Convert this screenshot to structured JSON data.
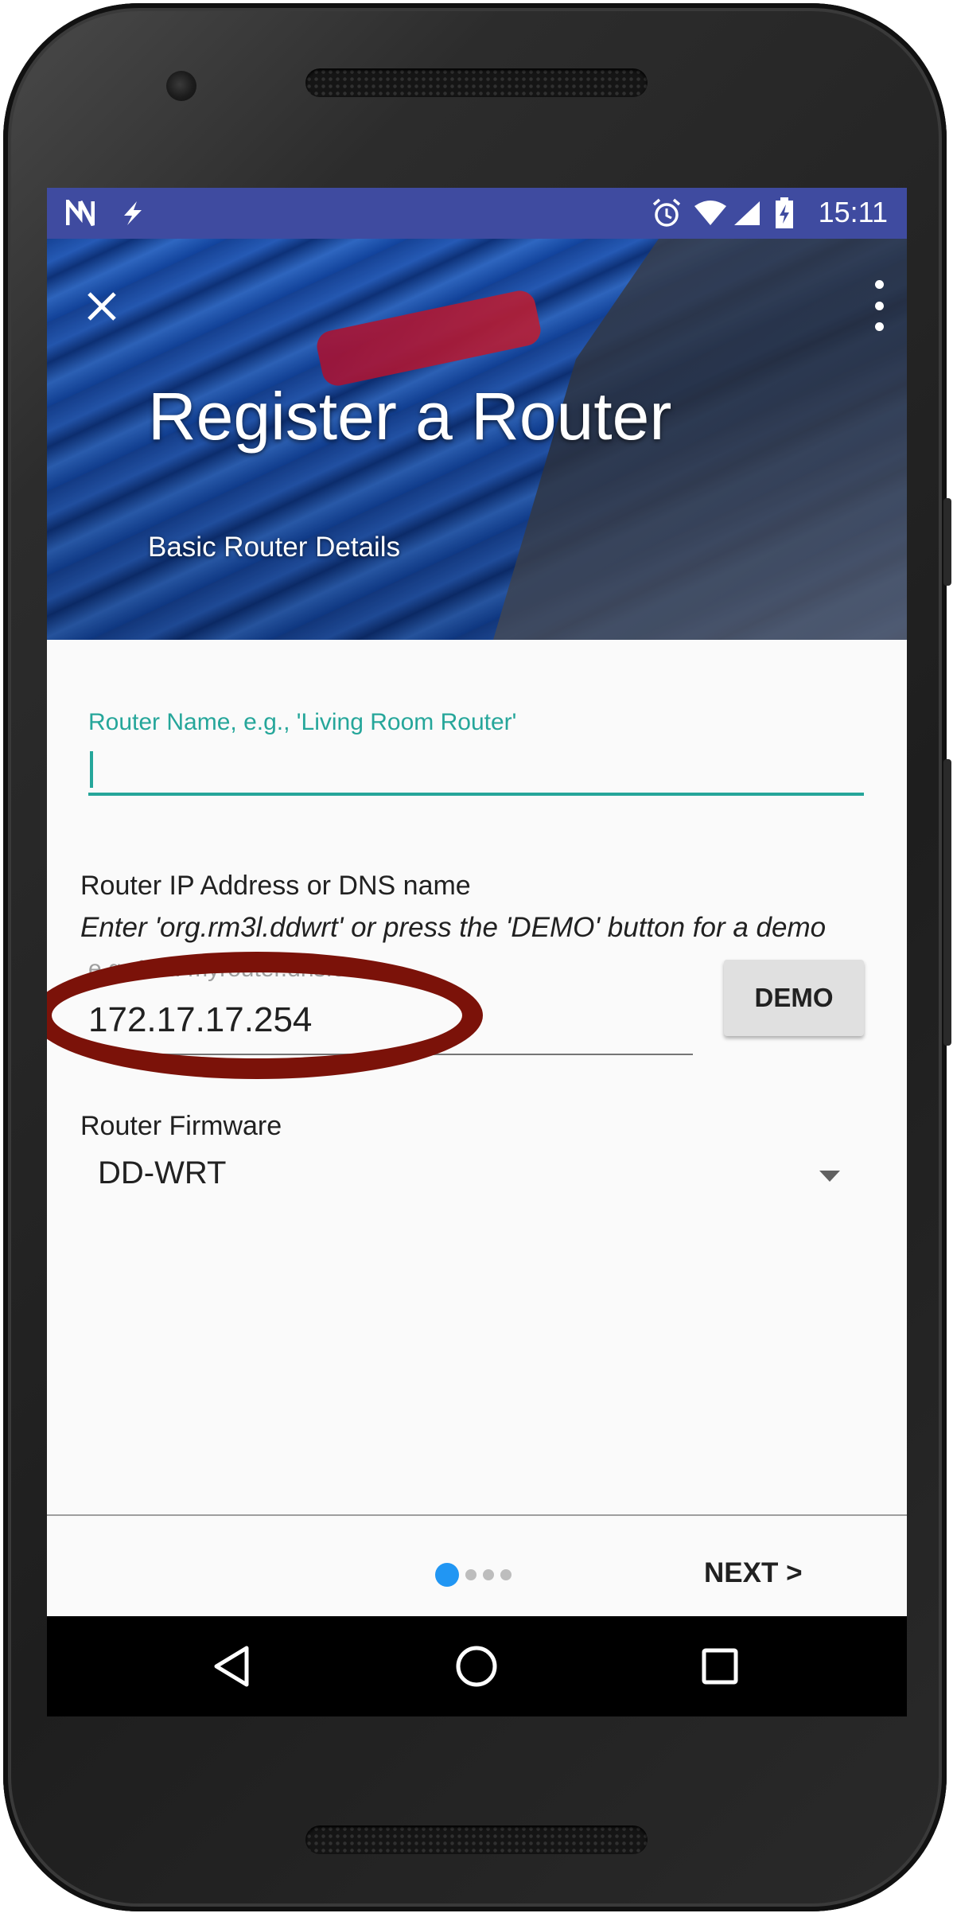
{
  "status_bar": {
    "time": "15:11",
    "left_icons": [
      "n-notification-icon",
      "bolt-icon"
    ],
    "right_icons": [
      "alarm-icon",
      "wifi-icon",
      "signal-icon",
      "battery-icon"
    ]
  },
  "header": {
    "title": "Register a Router",
    "subtitle": "Basic Router Details"
  },
  "form": {
    "router_name": {
      "label": "Router Name, e.g., 'Living Room Router'",
      "value": ""
    },
    "router_ip": {
      "label": "Router IP Address or DNS name",
      "hint": "Enter 'org.rm3l.ddwrt' or press the 'DEMO' button for a demo",
      "placeholder_visible": "e.g. 192.                     myrouter.dns.com",
      "value": "172.17.17.254"
    },
    "demo_button_label": "DEMO",
    "firmware": {
      "label": "Router Firmware",
      "selected": "DD-WRT"
    }
  },
  "wizard_nav": {
    "pages": 4,
    "current_page": 1,
    "next_label": "NEXT >"
  },
  "colors": {
    "status_bar": "#3f4ba0",
    "accent": "#25a69a",
    "pager_active": "#2196f3",
    "annotation_ellipse": "#7b1209"
  }
}
